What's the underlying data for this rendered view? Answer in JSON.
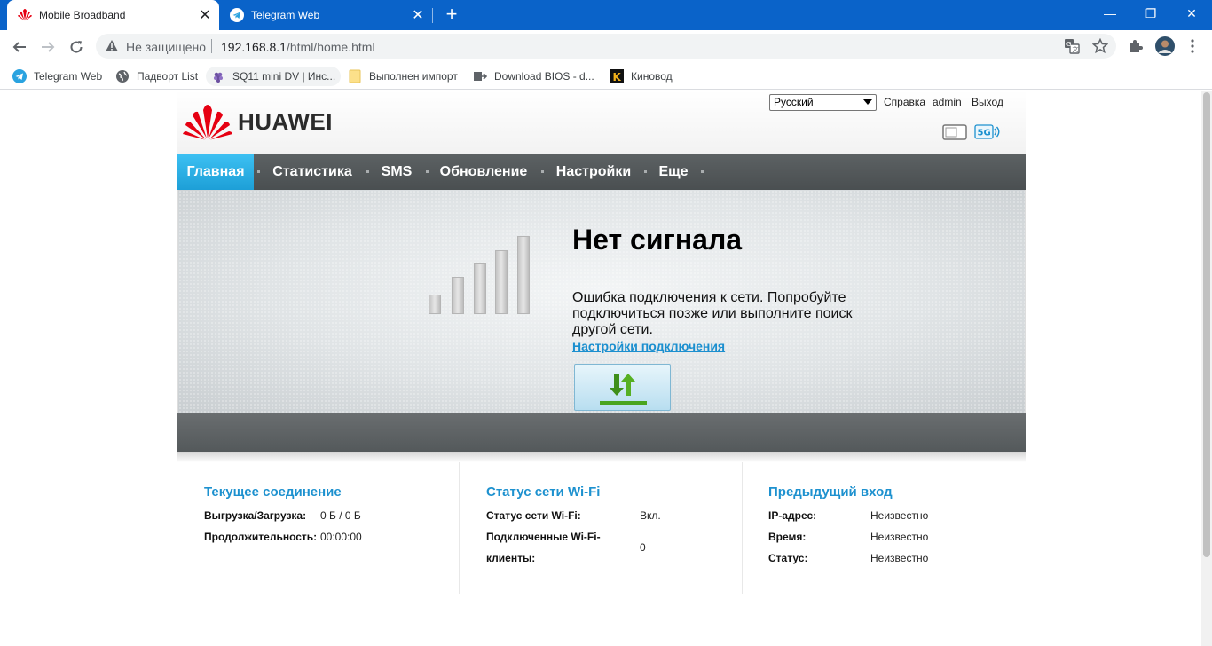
{
  "browser": {
    "tabs": [
      {
        "title": "Mobile Broadband",
        "active": true
      },
      {
        "title": "Telegram Web",
        "active": false
      }
    ],
    "security_label": "Не защищено",
    "url_host": "192.168.8.1",
    "url_path": "/html/home.html",
    "bookmarks": [
      {
        "label": "Telegram Web",
        "icon": "telegram-icon"
      },
      {
        "label": "Падворт List",
        "icon": "globe-icon"
      },
      {
        "label": "SQ11 mini DV | Инс...",
        "icon": "grape-icon"
      },
      {
        "label": "Выполнен импорт",
        "icon": "folder-icon"
      },
      {
        "label": "Download BIOS - d...",
        "icon": "bios-icon"
      },
      {
        "label": "Киновод",
        "icon": "kinovod-icon"
      }
    ]
  },
  "header": {
    "logo_text": "HUAWEI",
    "language_selected": "Русский",
    "help_label": "Справка",
    "user_label": "admin",
    "logout_label": "Выход",
    "band_label": "5G"
  },
  "nav": {
    "items": [
      {
        "label": "Главная",
        "active": true
      },
      {
        "label": "Статистика",
        "active": false
      },
      {
        "label": "SMS",
        "active": false
      },
      {
        "label": "Обновление",
        "active": false
      },
      {
        "label": "Настройки",
        "active": false
      },
      {
        "label": "Еще",
        "active": false
      }
    ]
  },
  "hero": {
    "status_title": "Нет сигнала",
    "status_message": "Ошибка подключения к сети. Попробуйте подключиться позже или выполните поиск другой сети.",
    "settings_link": "Настройки подключения",
    "signal_level": 0
  },
  "panels": {
    "current_connection": {
      "title": "Текущее соединение",
      "upload_download_label": "Выгрузка/Загрузка:",
      "upload_download_value": "0 Б / 0 Б",
      "duration_label": "Продолжительность:",
      "duration_value": "00:00:00"
    },
    "wifi_status": {
      "title": "Статус сети Wi-Fi",
      "status_label": "Статус сети Wi-Fi:",
      "status_value": "Вкл.",
      "clients_label_line1": "Подключенные Wi-Fi-",
      "clients_label_line2": "клиенты:",
      "clients_value": "0"
    },
    "previous_login": {
      "title": "Предыдущий вход",
      "ip_label": "IP-адрес:",
      "ip_value": "Неизвестно",
      "time_label": "Время:",
      "time_value": "Неизвестно",
      "status_label": "Статус:",
      "status_value": "Неизвестно"
    }
  },
  "colors": {
    "chrome_blue": "#0a63c9",
    "nav_active": "#1d9fd7",
    "panel_title": "#1d91cf",
    "huawei_red": "#e60012"
  }
}
